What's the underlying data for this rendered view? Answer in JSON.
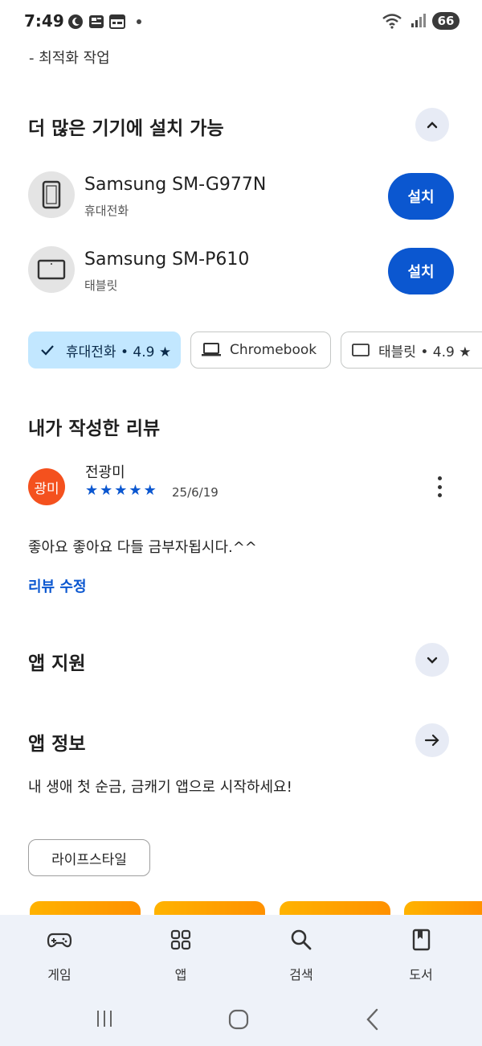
{
  "status_bar": {
    "time": "7:49",
    "battery": "66"
  },
  "top_cut_text": "- 최적화 작업",
  "devices_section": {
    "title": "더 많은 기기에 설치 가능",
    "devices": [
      {
        "name": "Samsung SM-G977N",
        "type": "휴대전화",
        "button": "설치"
      },
      {
        "name": "Samsung SM-P610",
        "type": "태블릿",
        "button": "설치"
      }
    ]
  },
  "device_chips": [
    {
      "label": "휴대전화 • 4.9 ★",
      "selected": true
    },
    {
      "label": "Chromebook",
      "selected": false
    },
    {
      "label": "태블릿 • 4.9 ★",
      "selected": false
    }
  ],
  "my_review": {
    "title": "내가 작성한 리뷰",
    "avatar_text": "광미",
    "reviewer": "전광미",
    "rating": 5,
    "date": "25/6/19",
    "text": "좋아요 좋아요 다들 금부자됩시다.^^",
    "edit_label": "리뷰 수정"
  },
  "app_support": {
    "title": "앱 지원"
  },
  "app_info": {
    "title": "앱 정보",
    "description": "내 생애 첫 순금, 금캐기 앱으로 시작하세요!",
    "category": "라이프스타일"
  },
  "bottom_nav": [
    {
      "label": "게임",
      "icon": "gamepad-icon"
    },
    {
      "label": "앱",
      "icon": "apps-grid-icon"
    },
    {
      "label": "검색",
      "icon": "search-icon"
    },
    {
      "label": "도서",
      "icon": "book-icon"
    }
  ],
  "colors": {
    "accent": "#0b57d0",
    "chip_selected": "#c2e7ff",
    "avatar": "#f4511e",
    "nav_bg": "#eef2f9"
  }
}
